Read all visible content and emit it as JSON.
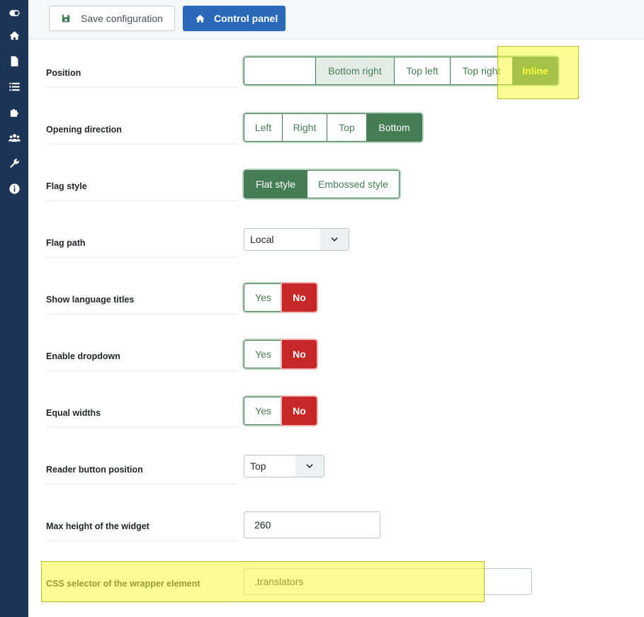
{
  "toolbar": {
    "save_label": "Save configuration",
    "control_panel_label": "Control panel"
  },
  "sidebar": {
    "icons": [
      "toggle-icon",
      "home-icon",
      "document-icon",
      "list-icon",
      "puzzle-icon",
      "users-icon",
      "wrench-icon",
      "info-icon"
    ]
  },
  "fields": {
    "position": {
      "label": "Position",
      "options": [
        "",
        "Bottom right",
        "Top left",
        "Top right",
        "Inline"
      ],
      "selected": "Inline"
    },
    "opening_direction": {
      "label": "Opening direction",
      "options": [
        "Left",
        "Right",
        "Top",
        "Bottom"
      ],
      "selected": "Bottom"
    },
    "flag_style": {
      "label": "Flag style",
      "options": [
        "Flat style",
        "Embossed style"
      ],
      "selected": "Flat style"
    },
    "flag_path": {
      "label": "Flag path",
      "value": "Local"
    },
    "show_language_titles": {
      "label": "Show language titles",
      "yes": "Yes",
      "no": "No",
      "selected": "No"
    },
    "enable_dropdown": {
      "label": "Enable dropdown",
      "yes": "Yes",
      "no": "No",
      "selected": "No"
    },
    "equal_widths": {
      "label": "Equal widths",
      "yes": "Yes",
      "no": "No",
      "selected": "No"
    },
    "reader_button_position": {
      "label": "Reader button position",
      "value": "Top"
    },
    "max_height": {
      "label": "Max height of the widget",
      "value": "260"
    },
    "css_selector": {
      "label": "CSS selector of the wrapper element",
      "value": ".translators"
    }
  },
  "colors": {
    "sidebar": "#1c3456",
    "success": "#457d54",
    "danger": "#c52827",
    "primary": "#2a69b8",
    "highlight": "#f5fc3c"
  }
}
